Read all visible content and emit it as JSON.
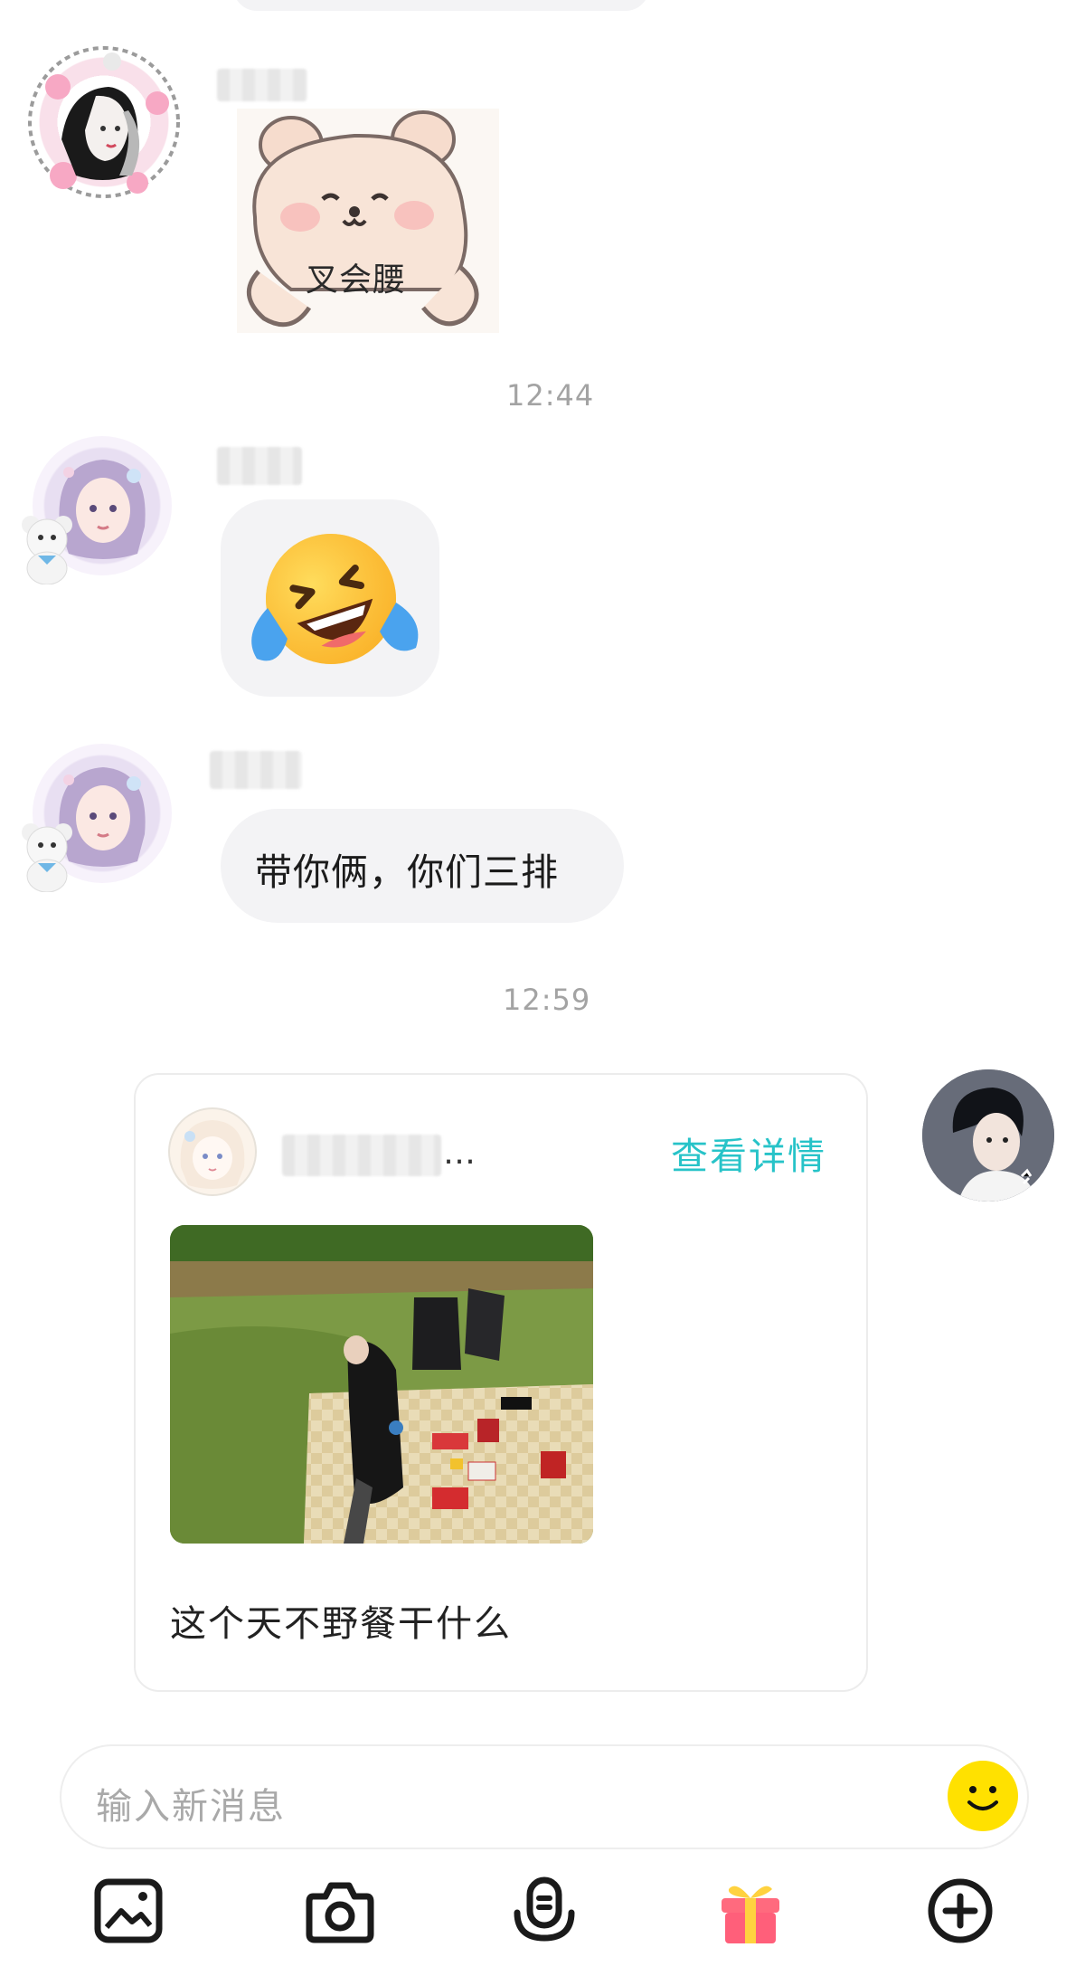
{
  "messages": {
    "sticker_caption": "叉会腰",
    "time_1": "12:44",
    "text_1": "带你俩，你们三排",
    "time_2": "12:59"
  },
  "shared_card": {
    "author_suffix": "…",
    "view_details": "查看详情",
    "caption": "这个天不野餐干什么"
  },
  "composer": {
    "placeholder": "输入新消息"
  },
  "toolbar": {
    "items": [
      "image-icon",
      "camera-icon",
      "voice-icon",
      "gift-icon",
      "plus-icon"
    ]
  },
  "colors": {
    "accent": "#27c3c8",
    "emoji_button": "#ffe100",
    "gift": "#ff5f7a"
  }
}
